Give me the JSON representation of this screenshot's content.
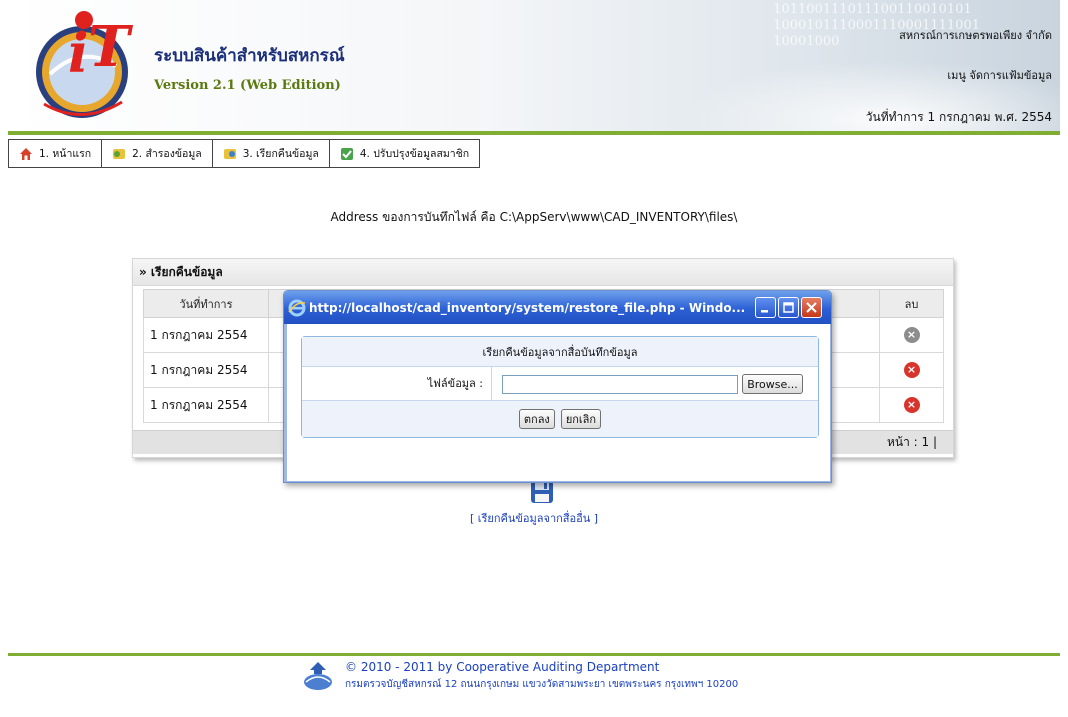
{
  "header": {
    "app_title": "ระบบสินค้าสำหรับสหกรณ์",
    "version": "Version 2.1 (Web Edition)",
    "coop_name": "สหกรณ์การเกษตรพอเพียง จำกัด",
    "menu_link": "เมนู จัดการแฟ้มข้อมูล",
    "work_date": "วันที่ทำการ 1 กรกฎาคม พ.ศ. 2554",
    "binary_text": "101100111011100110010101\n1000101110001110001111001\n10001000"
  },
  "nav": {
    "items": [
      {
        "label": "1. หน้าแรก",
        "icon": "home-icon"
      },
      {
        "label": "2. สำรองข้อมูล",
        "icon": "backup-icon"
      },
      {
        "label": "3. เรียกคืนข้อมูล",
        "icon": "restore-icon"
      },
      {
        "label": "4. ปรับปรุงข้อมูลสมาชิก",
        "icon": "update-members-icon"
      }
    ]
  },
  "address_line": "Address ของการบันทึกไฟล์ คือ C:\\AppServ\\www\\CAD_INVENTORY\\files\\",
  "panel": {
    "title": "» เรียกคืนข้อมูล",
    "columns": {
      "date": "วันที่ทำการ",
      "delete": "ลบ"
    },
    "rows": [
      {
        "date": "1 กรกฎาคม 2554",
        "delete_state": "disabled"
      },
      {
        "date": "1 กรกฎาคม 2554",
        "delete_state": "active"
      },
      {
        "date": "1 กรกฎาคม 2554",
        "delete_state": "active"
      }
    ],
    "pager": "หน้า : 1 |"
  },
  "restore_other_link": "[ เรียกคืนข้อมูลจากสื่ออื่น ]",
  "popup": {
    "window_title": "http://localhost/cad_inventory/system/restore_file.php - Windo...",
    "dialog_title": "เรียกคืนข้อมูลจากสื่อบันทึกข้อมูล",
    "file_label": "ไฟล์ข้อมูล :",
    "file_value": "",
    "browse_label": "Browse...",
    "ok_label": "ตกลง",
    "cancel_label": "ยกเลิก"
  },
  "footer": {
    "copyright": "© 2010 - 2011  by Cooperative Auditing Department",
    "address": "กรมตรวจบัญชีสหกรณ์ 12 ถนนกรุงเกษม แขวงวัดสามพระยา เขตพระนคร กรุงเทพฯ 10200"
  },
  "colors": {
    "accent_green": "#7fae32",
    "title_blue": "#1b2f7a",
    "link_blue": "#1a3fbf",
    "xp_titlebar": "#2b5fd5",
    "delete_red": "#d9342b"
  }
}
